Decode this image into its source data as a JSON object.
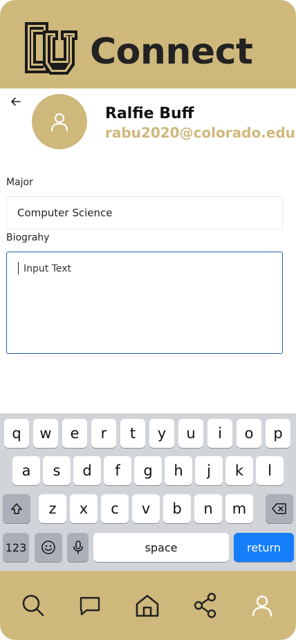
{
  "header": {
    "title": "Connect",
    "logo_text": "CU"
  },
  "profile": {
    "name": "Ralfie Buff",
    "email": "rabu2020@colorado.edu"
  },
  "form": {
    "major_label": "Major",
    "major_value": "Computer Science",
    "bio_label": "Biograhy",
    "bio_placeholder": "Input Text"
  },
  "keyboard": {
    "row1": [
      "q",
      "w",
      "e",
      "r",
      "t",
      "y",
      "u",
      "i",
      "o",
      "p"
    ],
    "row2": [
      "a",
      "s",
      "d",
      "f",
      "g",
      "h",
      "j",
      "k",
      "l"
    ],
    "row3": [
      "z",
      "x",
      "c",
      "v",
      "b",
      "n",
      "m"
    ],
    "numbers_label": "123",
    "space_label": "space",
    "return_label": "return"
  },
  "nav": {
    "items": [
      "search-icon",
      "chat-icon",
      "home-icon",
      "share-icon",
      "profile-icon"
    ]
  },
  "colors": {
    "gold": "#cfb87c",
    "black": "#222222",
    "accent_blue": "#147efb"
  }
}
